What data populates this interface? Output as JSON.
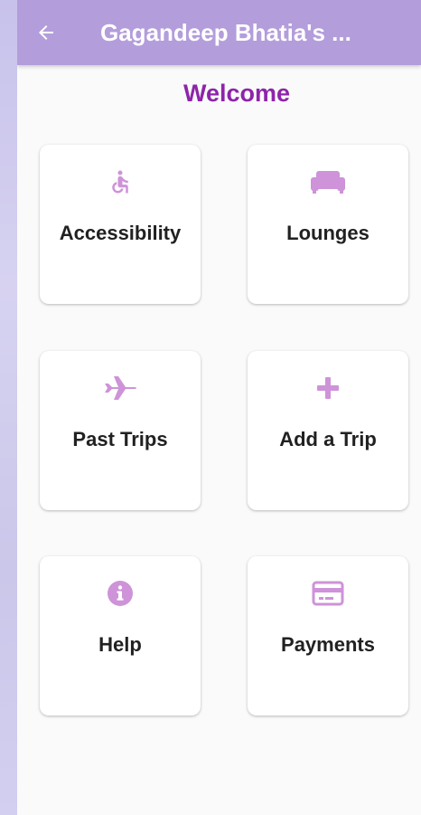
{
  "appbar": {
    "title": "Gagandeep Bhatia's ...",
    "color": "#b39ddb"
  },
  "welcome": {
    "text": "Welcome",
    "color": "#8e24aa"
  },
  "icon_color": "#ce93d8",
  "tiles": [
    {
      "label": "Accessibility",
      "icon": "accessible-icon"
    },
    {
      "label": "Lounges",
      "icon": "sofa-icon"
    },
    {
      "label": "Past Trips",
      "icon": "airplane-icon"
    },
    {
      "label": "Add a Trip",
      "icon": "plus-icon"
    },
    {
      "label": "Help",
      "icon": "info-icon"
    },
    {
      "label": "Payments",
      "icon": "credit-card-icon"
    }
  ]
}
